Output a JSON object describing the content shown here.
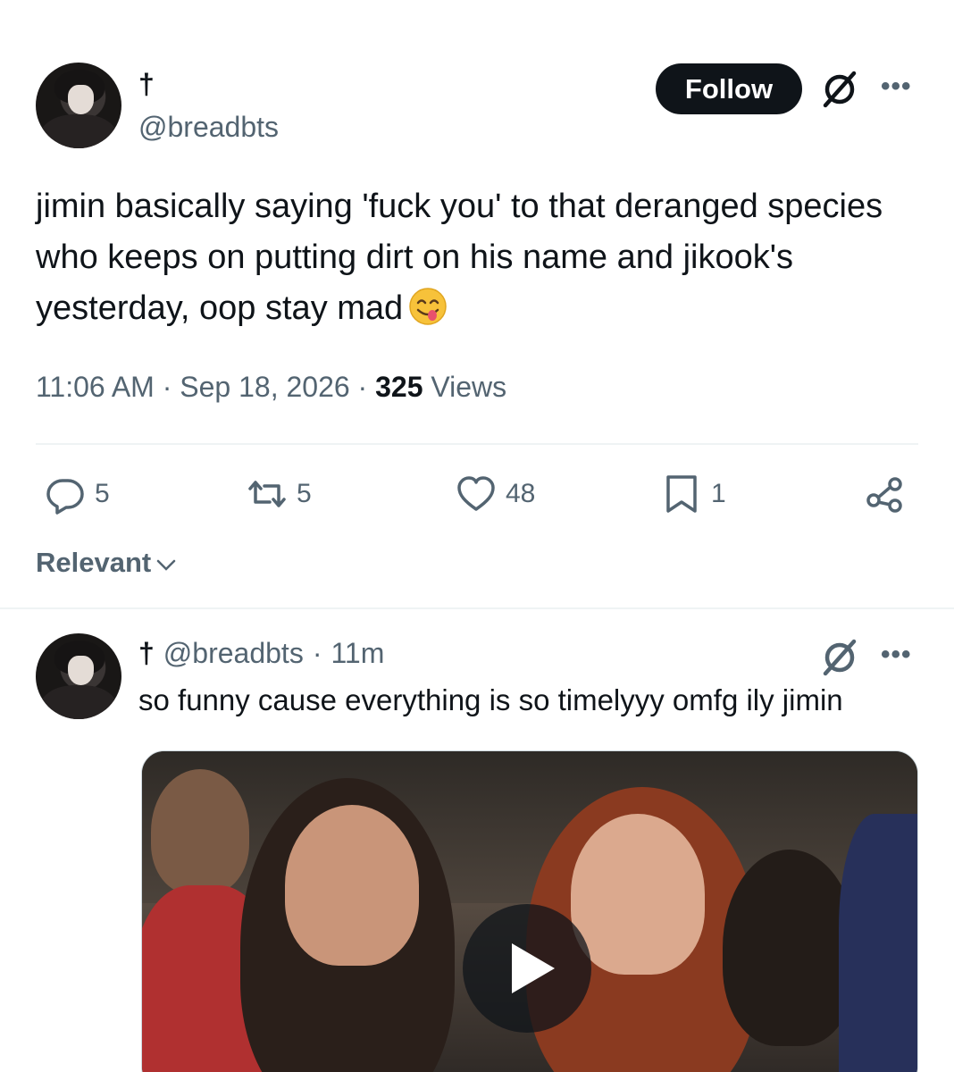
{
  "tweet": {
    "display_name": "†",
    "handle": "@breadbts",
    "follow_label": "Follow",
    "text": "jimin basically saying 'fuck you' to that deranged species who keeps on putting dirt on his name and jikook's yesterday, oop stay mad",
    "emoji": "face-savoring-food-emoji",
    "time": "11:06 AM",
    "date": "Sep 18, 2026",
    "views_count": "325",
    "views_label": "Views",
    "separator": "·"
  },
  "actions": {
    "replies": "5",
    "reposts": "5",
    "likes": "48",
    "bookmarks": "1"
  },
  "icons": {
    "reply": "reply-icon",
    "repost": "repost-icon",
    "like": "heart-icon",
    "bookmark": "bookmark-icon",
    "share": "share-icon",
    "grok": "grok-icon",
    "more": "more-icon",
    "play": "play-icon",
    "chevron": "chevron-down-icon"
  },
  "sort": {
    "label": "Relevant"
  },
  "reply": {
    "display_name": "†",
    "handle": "@breadbts",
    "separator": "·",
    "time": "11m",
    "text": "so funny cause everything is so timelyyy omfg ily jimin"
  },
  "colors": {
    "text": "#0f1419",
    "secondary": "#536471",
    "follow_bg": "#0f1419",
    "divider": "#eff3f4"
  }
}
